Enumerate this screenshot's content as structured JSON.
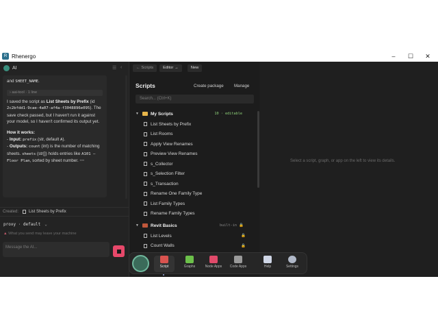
{
  "window": {
    "title": "Rhenergo",
    "controls": [
      "–",
      "☐",
      "✕"
    ]
  },
  "ai": {
    "title": "AI",
    "message": {
      "intro_and": "and ",
      "intro_code": "SHEET_NAME",
      "intro_end": ".",
      "tool_label": "› aai-tool · 1 line",
      "saved_1": "I saved the script as ",
      "saved_name": "List Sheets by Prefix",
      "saved_2": " (id ",
      "saved_id_a": "2c2bfdd1-9cae-4a07-af4a-",
      "saved_id_b": "f3048896e095",
      "saved_3": "). The save check passed, but I haven't run it against your model, so I haven't confirmed its output yet.",
      "how_title": "How it works:",
      "input_label": "Input:",
      "input_code": "prefix",
      "input_text_1": " (str, default ",
      "input_code_2": "A",
      "input_text_2": ").",
      "output_label": "Outputs:",
      "output_code": "count",
      "output_text_1": " (int) is the number of matching sheets. ",
      "output_code_2": "sheets",
      "output_text_2": " (str[]) holds entries like ",
      "output_code_3": "A101 – Floor Plan",
      "output_text_3": ", sorted by sheet number.",
      "more": "•••"
    },
    "created_label": "Created:",
    "created_item": "List Sheets by Prefix",
    "proxy_value": "proxy · default",
    "warning": "What you send may leave your machine",
    "input_placeholder": "Message the AI..."
  },
  "toolbar": {
    "back": "← Scripts",
    "editor": "Editor →",
    "new": "New"
  },
  "scripts": {
    "title": "Scripts",
    "create_package": "Create package",
    "manage": "Manage",
    "search_placeholder": "Search... (Ctrl+K)",
    "my_scripts": {
      "label": "My Scripts",
      "tag": "10 · editable",
      "items": [
        "List Sheets by Prefix",
        "List Rooms",
        "Apply View Renames",
        "Preview View Renames",
        "s_Collector",
        "s_Selection Filter",
        "s_Transaction",
        "Rename One Family Type",
        "List Family Types",
        "Rename Family Types"
      ]
    },
    "revit_basics": {
      "label": "Revit Basics",
      "tag": "built-in",
      "items": [
        "List Levels",
        "Count Walls"
      ]
    }
  },
  "detail": {
    "empty_text": "Select a script, graph, or app on the left to view its details."
  },
  "dock": {
    "items": [
      {
        "label": "Script",
        "icon": "script-icon",
        "color": "#d9534f"
      },
      {
        "label": "Graphs",
        "icon": "puzzle-icon",
        "color": "#6cc04a"
      },
      {
        "label": "Node Apps",
        "icon": "node-apps-icon",
        "color": "#e04a6a"
      },
      {
        "label": "Code Apps",
        "icon": "code-apps-icon",
        "color": "#9a9a9a"
      },
      {
        "label": "Help",
        "icon": "book-icon",
        "color": "#cfd6e6"
      },
      {
        "label": "Settings",
        "icon": "gear-icon",
        "color": "#b0b8c8"
      }
    ]
  },
  "colors": {
    "accent_send": "#e7486a",
    "editable_tag": "#8fd37a",
    "folder": "#e7b54a"
  }
}
